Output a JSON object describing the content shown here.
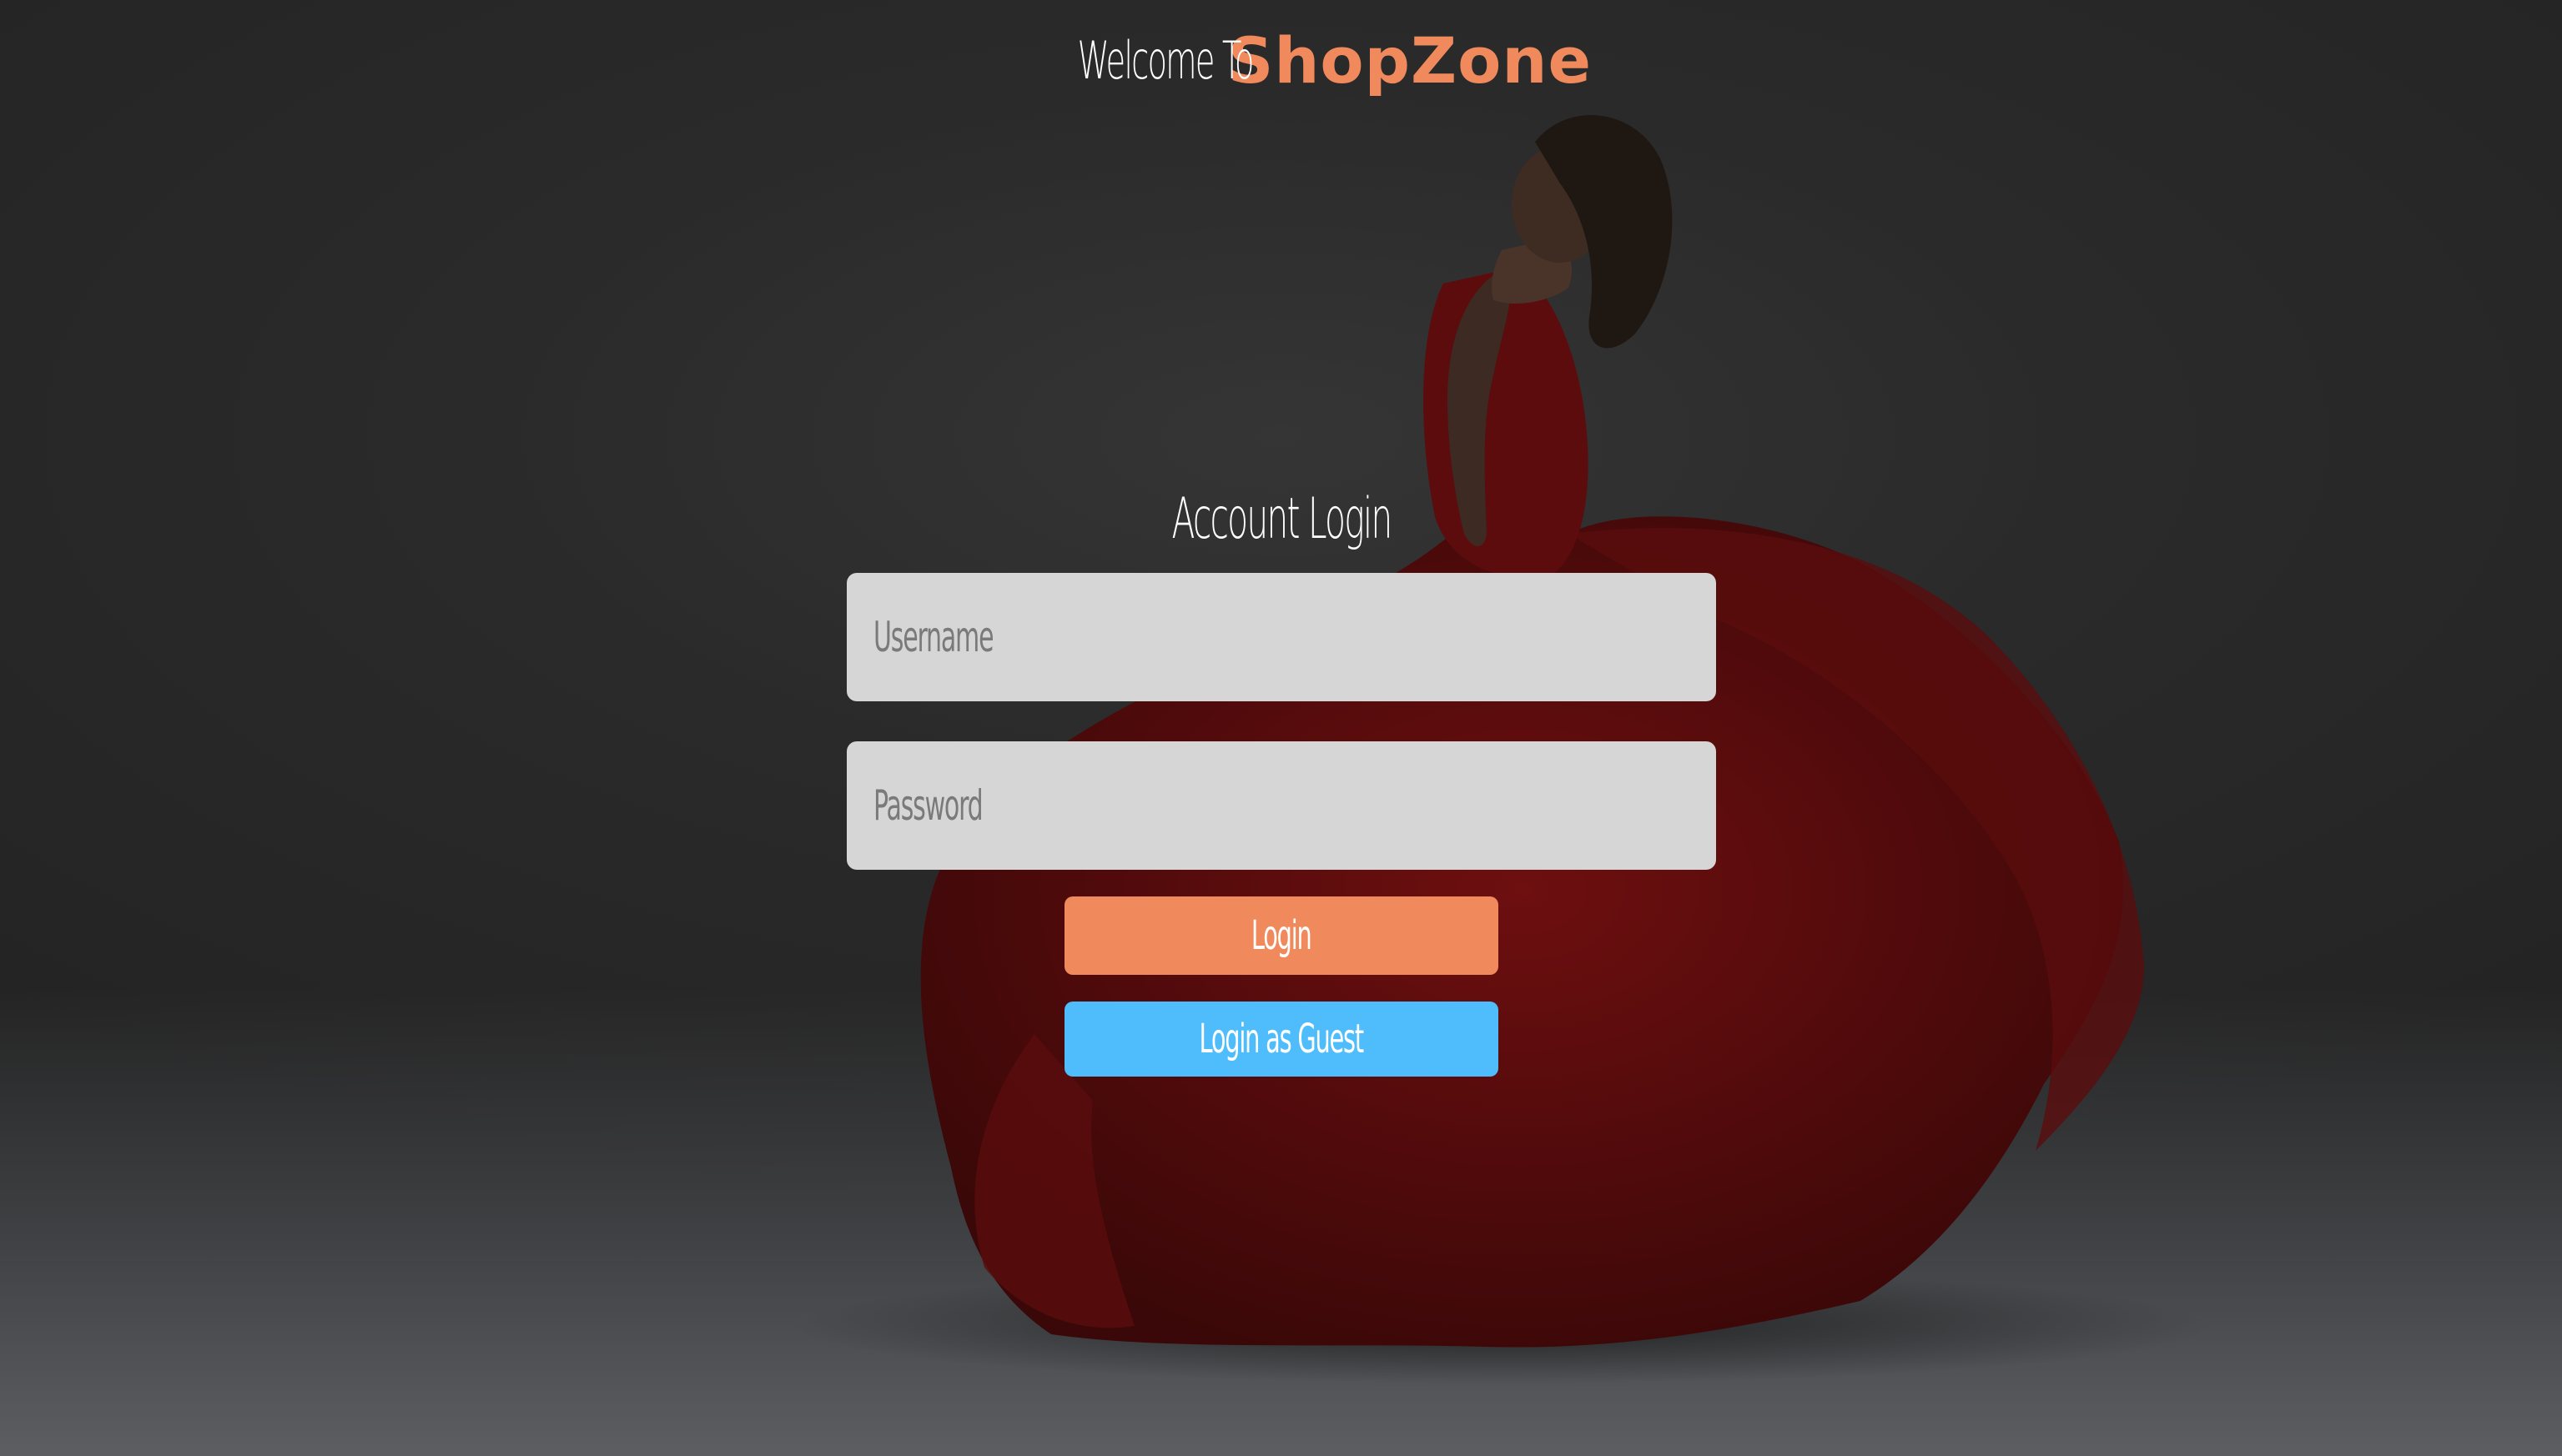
{
  "header": {
    "welcome": "Welcome To",
    "brand": "ShopZone"
  },
  "login": {
    "title": "Account Login",
    "username_placeholder": "Username",
    "password_placeholder": "Password",
    "login_label": "Login",
    "guest_label": "Login as Guest"
  },
  "colors": {
    "brand": "#f08a5d",
    "login_button": "#f08a5d",
    "guest_button": "#4fbdfb",
    "field_bg": "#d6d6d6",
    "background": "#2a2a2a"
  },
  "background_image": "woman in red flowing gown"
}
